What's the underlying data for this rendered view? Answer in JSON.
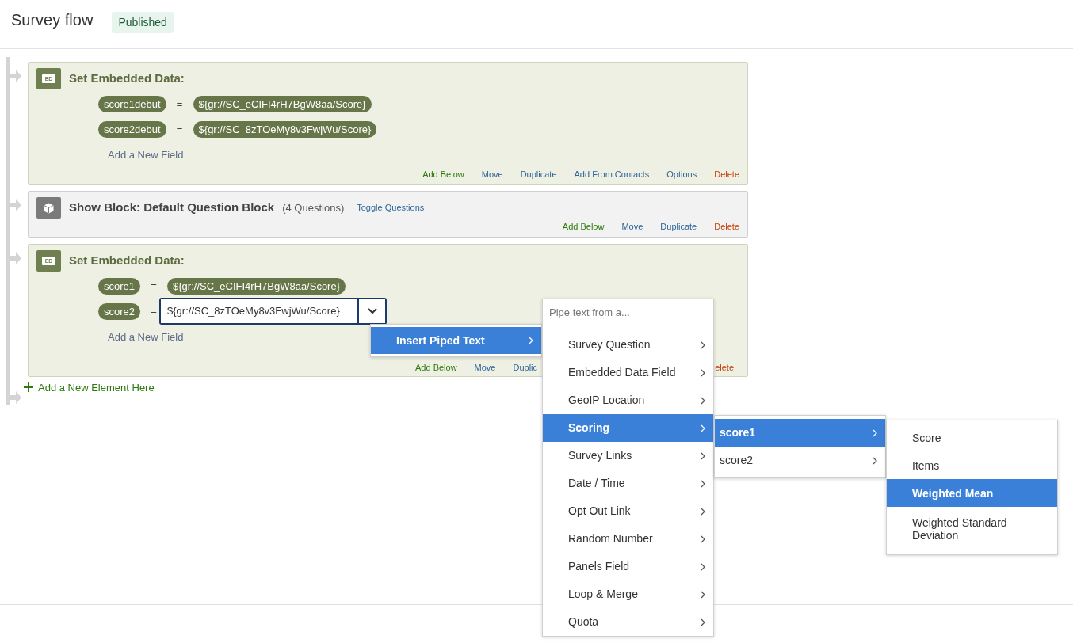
{
  "header": {
    "title": "Survey flow",
    "status_badge": "Published"
  },
  "flow": [
    {
      "kind": "embedded_data",
      "icon_label": "ED",
      "title": "Set Embedded Data:",
      "fields": [
        {
          "name": "score1debut",
          "operator": "=",
          "value": "${gr://SC_eCIFI4rH7BgW8aa/Score}",
          "editing": false
        },
        {
          "name": "score2debut",
          "operator": "=",
          "value": "${gr://SC_8zTOeMy8v3FwjWu/Score}",
          "editing": false
        }
      ],
      "add_field": "Add a New Field",
      "actions": [
        {
          "label": "Add Below",
          "kind": "add"
        },
        {
          "label": "Move",
          "kind": "normal"
        },
        {
          "label": "Duplicate",
          "kind": "normal"
        },
        {
          "label": "Add From Contacts",
          "kind": "normal"
        },
        {
          "label": "Options",
          "kind": "normal"
        },
        {
          "label": "Delete",
          "kind": "delete"
        }
      ]
    },
    {
      "kind": "block",
      "title": "Show Block: Default Question Block",
      "count": "(4 Questions)",
      "toggle": "Toggle Questions",
      "actions": [
        {
          "label": "Add Below",
          "kind": "add"
        },
        {
          "label": "Move",
          "kind": "normal"
        },
        {
          "label": "Duplicate",
          "kind": "normal"
        },
        {
          "label": "Delete",
          "kind": "delete"
        }
      ]
    },
    {
      "kind": "embedded_data",
      "icon_label": "ED",
      "title": "Set Embedded Data:",
      "fields": [
        {
          "name": "score1",
          "operator": "=",
          "value": "${gr://SC_eCIFI4rH7BgW8aa/Score}",
          "editing": false
        },
        {
          "name": "score2",
          "operator": "=",
          "value": "${gr://SC_8zTOeMy8v3FwjWu/Score}",
          "editing": true
        }
      ],
      "add_field": "Add a New Field",
      "actions": [
        {
          "label": "Add Below",
          "kind": "add"
        },
        {
          "label": "Move",
          "kind": "normal"
        },
        {
          "label": "Duplic",
          "kind": "normal"
        },
        {
          "label": "elete",
          "kind": "delete"
        }
      ]
    }
  ],
  "add_element": "Add a New Element Here",
  "menus": {
    "insert": {
      "items": [
        {
          "label": "Insert Piped Text",
          "selected": true
        }
      ]
    },
    "pipe": {
      "placeholder": "Pipe text from a...",
      "items": [
        {
          "label": "Survey Question",
          "selected": false
        },
        {
          "label": "Embedded Data Field",
          "selected": false
        },
        {
          "label": "GeoIP Location",
          "selected": false
        },
        {
          "label": "Scoring",
          "selected": true
        },
        {
          "label": "Survey Links",
          "selected": false
        },
        {
          "label": "Date / Time",
          "selected": false
        },
        {
          "label": "Opt Out Link",
          "selected": false
        },
        {
          "label": "Random Number",
          "selected": false
        },
        {
          "label": "Panels Field",
          "selected": false
        },
        {
          "label": "Loop & Merge",
          "selected": false
        },
        {
          "label": "Quota",
          "selected": false
        }
      ]
    },
    "scoring": {
      "items": [
        {
          "label": "score1",
          "selected": true
        },
        {
          "label": "score2",
          "selected": false
        }
      ]
    },
    "score_fields": {
      "items": [
        {
          "label": "Score",
          "selected": false
        },
        {
          "label": "Items",
          "selected": false
        },
        {
          "label": "Weighted Mean",
          "selected": true
        },
        {
          "label": "Weighted Standard Deviation",
          "selected": false
        }
      ]
    }
  }
}
